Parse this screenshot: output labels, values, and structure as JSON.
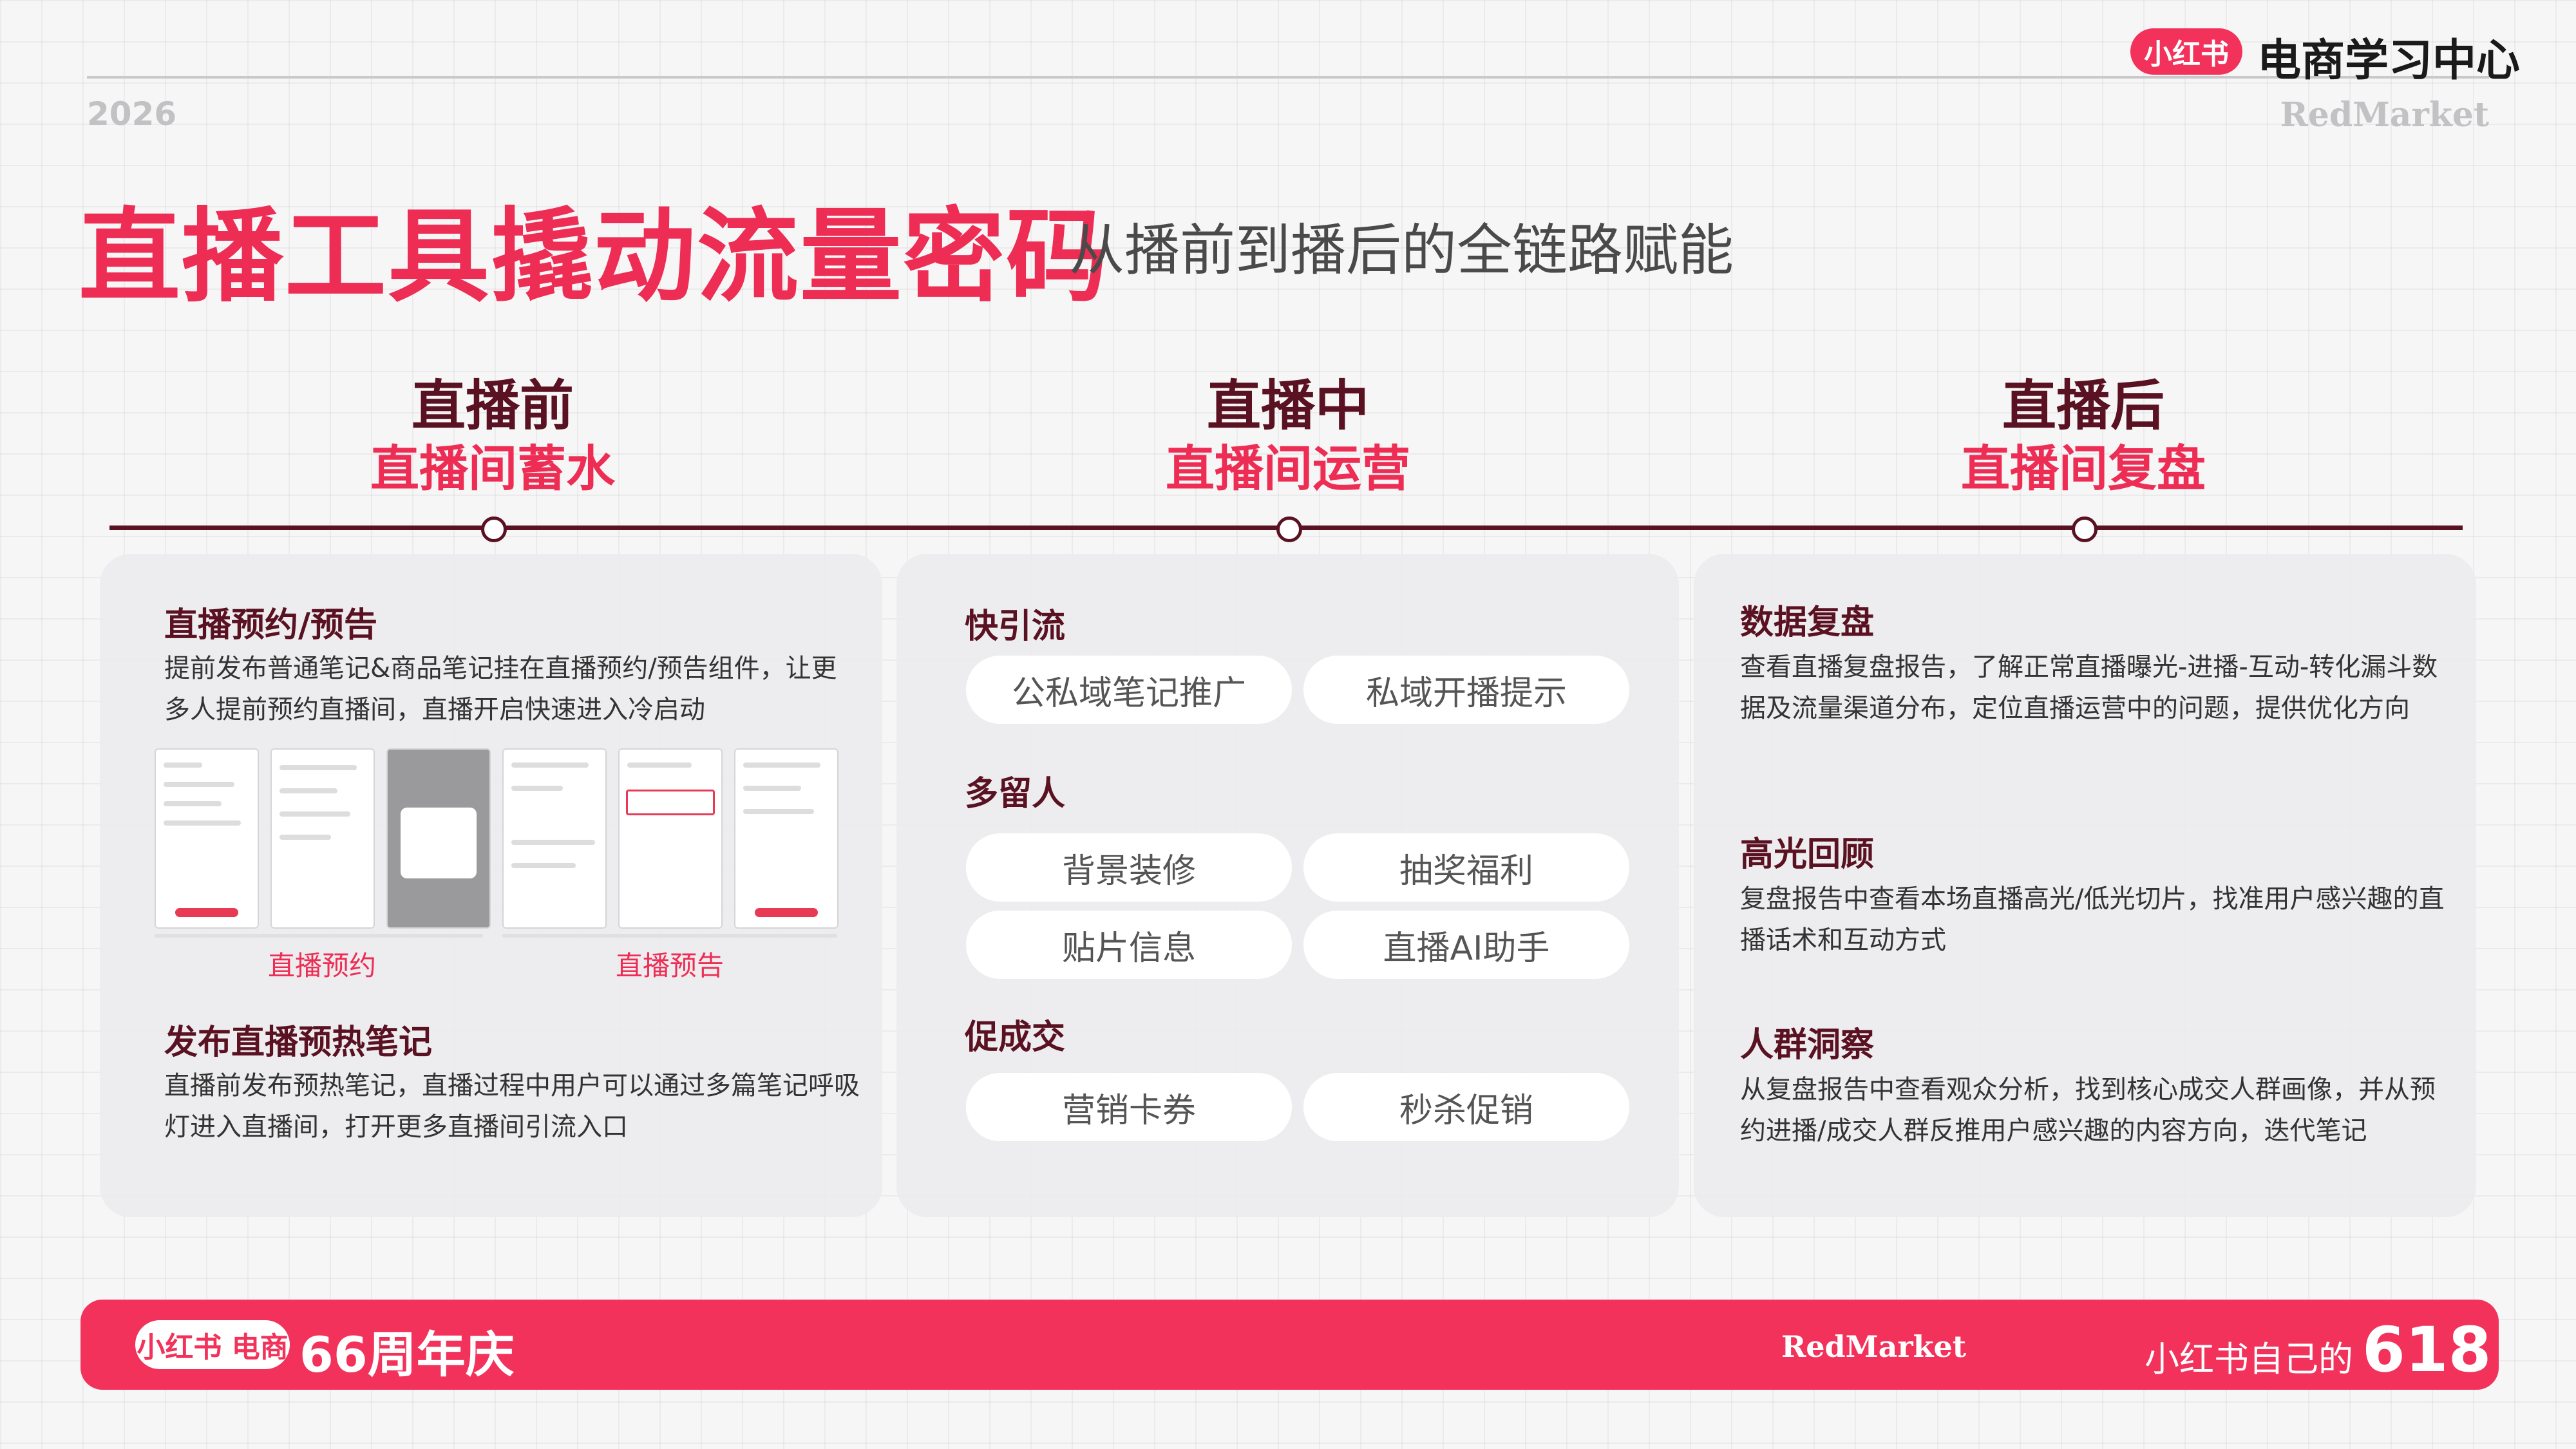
{
  "header": {
    "logo": "小红书",
    "center_name": "电商学习中心",
    "year": "2026",
    "brand": "RedMarket"
  },
  "title": {
    "main": "直播工具撬动流量密码",
    "sub": "从播前到播后的全链路赋能"
  },
  "stages": [
    {
      "name": "直播前",
      "sub": "直播间蓄水"
    },
    {
      "name": "直播中",
      "sub": "直播间运营"
    },
    {
      "name": "直播后",
      "sub": "直播间复盘"
    }
  ],
  "before": {
    "sec1_title": "直播预约/预告",
    "sec1_body": "提前发布普通笔记&商品笔记挂在直播预约/预告组件，让更多人提前预约直播间，直播开启快速进入冷启动",
    "shot_label_1": "直播预约",
    "shot_label_2": "直播预告",
    "sec2_title": "发布直播预热笔记",
    "sec2_body": "直播前发布预热笔记，直播过程中用户可以通过多篇笔记呼吸灯进入直播间，打开更多直播间引流入口"
  },
  "during": {
    "groups": [
      {
        "title": "快引流",
        "items": [
          "公私域笔记推广",
          "私域开播提示"
        ]
      },
      {
        "title": "多留人",
        "items": [
          "背景装修",
          "抽奖福利",
          "贴片信息",
          "直播AI助手"
        ]
      },
      {
        "title": "促成交",
        "items": [
          "营销卡券",
          "秒杀促销"
        ]
      }
    ]
  },
  "after": {
    "sections": [
      {
        "title": "数据复盘",
        "body": "查看直播复盘报告，了解正常直播曝光-进播-互动-转化漏斗数据及流量渠道分布，定位直播运营中的问题，提供优化方向"
      },
      {
        "title": "高光回顾",
        "body": "复盘报告中查看本场直播高光/低光切片，找准用户感兴趣的直播话术和互动方式"
      },
      {
        "title": "人群洞察",
        "body": "从复盘报告中查看观众分析，找到核心成交人群画像，并从预约进播/成交人群反推用户感兴趣的内容方向，迭代笔记"
      }
    ]
  },
  "footer": {
    "pill": "小红书 电商",
    "anniversary": "66周年庆",
    "brand": "RedMarket",
    "slogan_prefix": "小红书自己的",
    "slogan_num": "618"
  },
  "colors": {
    "accent": "#ee2d55",
    "dark_red": "#5a1222",
    "footer": "#f2325a"
  }
}
